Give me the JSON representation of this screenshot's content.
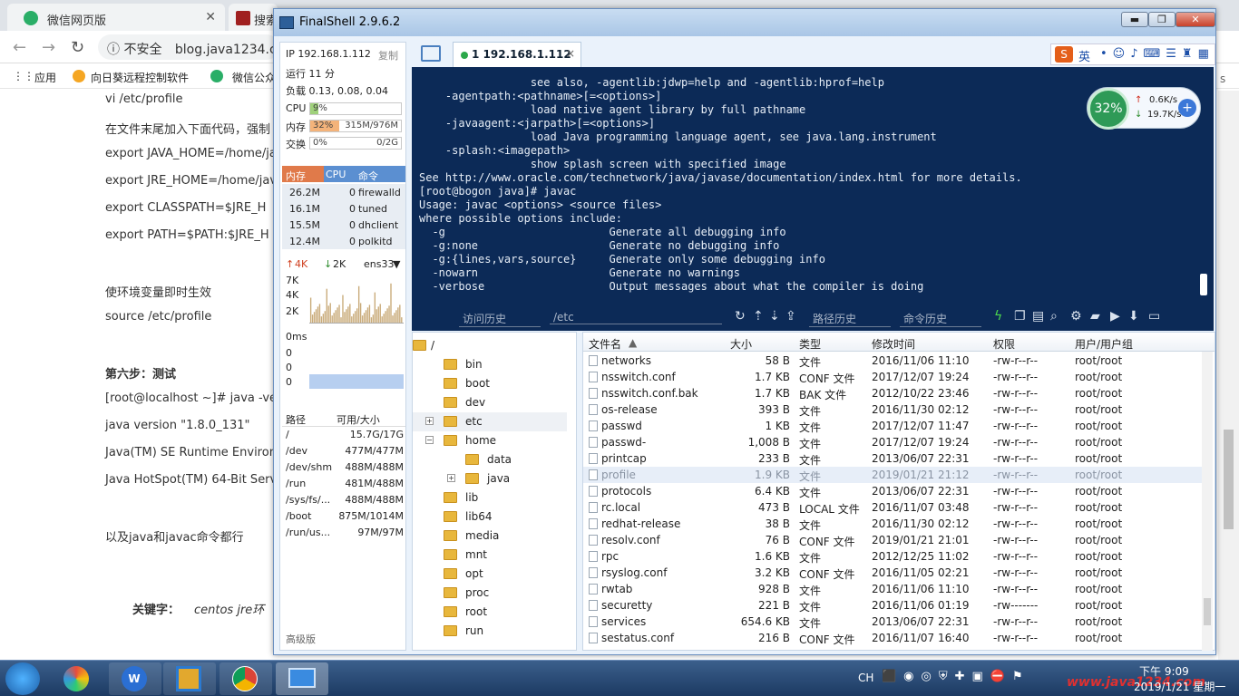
{
  "browser": {
    "tabs": [
      {
        "label": "微信网页版",
        "color": "#2aae67"
      },
      {
        "label": "搜索",
        "color": "#a02020"
      }
    ],
    "insecure": "不安全",
    "url": "blog.java1234.c",
    "bookmarks": [
      "应用",
      "向日葵远程控制软件",
      "微信公众"
    ],
    "article": [
      "vi /etc/profile",
      "在文件末尾加入下面代码，强制",
      "export JAVA_HOME=/home/ja",
      "export JRE_HOME=/home/jav",
      "export CLASSPATH=$JRE_H",
      "export PATH=$PATH:$JRE_H",
      "使环境变量即时生效",
      "source /etc/profile",
      "第六步：测试",
      "[root@localhost ~]# java -vers",
      "java version \"1.8.0_131\"",
      "Java(TM) SE Runtime Environ",
      "Java HotSpot(TM) 64-Bit Serv",
      "以及java和javac命令都行"
    ],
    "keywords_label": "关键字：",
    "keywords": "centos    jre环",
    "right_text": "s"
  },
  "window": {
    "title": "FinalShell 2.9.6.2",
    "min": "▬",
    "max": "❐",
    "close": "✕"
  },
  "sysinfo": {
    "ip_label": "IP 192.168.1.112",
    "copy": "复制",
    "uptime": "运行 11 分",
    "load": "负载 0.13, 0.08, 0.04",
    "cpu_label": "CPU",
    "cpu_val": "9%",
    "cpu_pct": 9,
    "mem_label": "内存",
    "mem_val": "32%",
    "mem_detail": "315M/976M",
    "mem_pct": 32,
    "swap_label": "交换",
    "swap_val": "0%",
    "swap_detail": "0/2G",
    "swap_pct": 0,
    "proc_headers": [
      "内存",
      "CPU",
      "命令"
    ],
    "procs": [
      {
        "mem": "26.2M",
        "cpu": "0",
        "cmd": "firewalld"
      },
      {
        "mem": "16.1M",
        "cpu": "0",
        "cmd": "tuned"
      },
      {
        "mem": "15.5M",
        "cpu": "0",
        "cmd": "dhclient"
      },
      {
        "mem": "12.4M",
        "cpu": "0",
        "cmd": "polkitd"
      }
    ],
    "net_up": "4K",
    "net_down": "2K",
    "iface": "ens33",
    "net_scale": [
      "7K",
      "4K",
      "2K"
    ],
    "ping_label": "0ms",
    "ping_scale": [
      "0",
      "0",
      "0"
    ],
    "disk_headers": [
      "路径",
      "可用/大小"
    ],
    "disks": [
      {
        "path": "/",
        "size": "15.7G/17G"
      },
      {
        "path": "/dev",
        "size": "477M/477M"
      },
      {
        "path": "/dev/shm",
        "size": "488M/488M"
      },
      {
        "path": "/run",
        "size": "481M/488M"
      },
      {
        "path": "/sys/fs/...",
        "size": "488M/488M"
      },
      {
        "path": "/boot",
        "size": "875M/1014M"
      },
      {
        "path": "/run/us...",
        "size": "97M/97M"
      }
    ],
    "advanced": "高级版"
  },
  "session_tab": {
    "label": "1 192.168.1.112",
    "close": "×"
  },
  "terminal_lines": [
    "                 see also, -agentlib:jdwp=help and -agentlib:hprof=help",
    "    -agentpath:<pathname>[=<options>]",
    "                 load native agent library by full pathname",
    "    -javaagent:<jarpath>[=<options>]",
    "                 load Java programming language agent, see java.lang.instrument",
    "    -splash:<imagepath>",
    "                 show splash screen with specified image",
    "See http://www.oracle.com/technetwork/java/javase/documentation/index.html for more details.",
    "[root@bogon java]# javac",
    "Usage: javac <options> <source files>",
    "where possible options include:",
    "  -g                         Generate all debugging info",
    "  -g:none                    Generate no debugging info",
    "  -g:{lines,vars,source}     Generate only some debugging info",
    "  -nowarn                    Generate no warnings",
    "  -verbose                   Output messages about what the compiler is doing"
  ],
  "term_toolbar": {
    "history": "访问历史",
    "path": "/etc",
    "path_history": "路径历史",
    "cmd_history": "命令历史"
  },
  "netwidget": {
    "pct": "32%",
    "up": "0.6K/s",
    "down": "19.7K/s"
  },
  "tree": [
    {
      "label": "/",
      "indent": 0,
      "exp": ""
    },
    {
      "label": "bin",
      "indent": 1,
      "exp": ""
    },
    {
      "label": "boot",
      "indent": 1,
      "exp": ""
    },
    {
      "label": "dev",
      "indent": 1,
      "exp": ""
    },
    {
      "label": "etc",
      "indent": 1,
      "exp": "+"
    },
    {
      "label": "home",
      "indent": 1,
      "exp": "−"
    },
    {
      "label": "data",
      "indent": 2,
      "exp": ""
    },
    {
      "label": "java",
      "indent": 2,
      "exp": "+"
    },
    {
      "label": "lib",
      "indent": 1,
      "exp": ""
    },
    {
      "label": "lib64",
      "indent": 1,
      "exp": ""
    },
    {
      "label": "media",
      "indent": 1,
      "exp": ""
    },
    {
      "label": "mnt",
      "indent": 1,
      "exp": ""
    },
    {
      "label": "opt",
      "indent": 1,
      "exp": ""
    },
    {
      "label": "proc",
      "indent": 1,
      "exp": ""
    },
    {
      "label": "root",
      "indent": 1,
      "exp": ""
    },
    {
      "label": "run",
      "indent": 1,
      "exp": ""
    }
  ],
  "files": {
    "headers": [
      "文件名",
      "大小",
      "类型",
      "修改时间",
      "权限",
      "用户/用户组"
    ],
    "rows": [
      [
        "networks",
        "58 B",
        "文件",
        "2016/11/06 11:10",
        "-rw-r--r--",
        "root/root"
      ],
      [
        "nsswitch.conf",
        "1.7 KB",
        "CONF 文件",
        "2017/12/07 19:24",
        "-rw-r--r--",
        "root/root"
      ],
      [
        "nsswitch.conf.bak",
        "1.7 KB",
        "BAK 文件",
        "2012/10/22 23:46",
        "-rw-r--r--",
        "root/root"
      ],
      [
        "os-release",
        "393 B",
        "文件",
        "2016/11/30 02:12",
        "-rw-r--r--",
        "root/root"
      ],
      [
        "passwd",
        "1 KB",
        "文件",
        "2017/12/07 11:47",
        "-rw-r--r--",
        "root/root"
      ],
      [
        "passwd-",
        "1,008 B",
        "文件",
        "2017/12/07 19:24",
        "-rw-r--r--",
        "root/root"
      ],
      [
        "printcap",
        "233 B",
        "文件",
        "2013/06/07 22:31",
        "-rw-r--r--",
        "root/root"
      ],
      [
        "profile",
        "1.9 KB",
        "文件",
        "2019/01/21 21:12",
        "-rw-r--r--",
        "root/root"
      ],
      [
        "protocols",
        "6.4 KB",
        "文件",
        "2013/06/07 22:31",
        "-rw-r--r--",
        "root/root"
      ],
      [
        "rc.local",
        "473 B",
        "LOCAL 文件",
        "2016/11/07 03:48",
        "-rw-r--r--",
        "root/root"
      ],
      [
        "redhat-release",
        "38 B",
        "文件",
        "2016/11/30 02:12",
        "-rw-r--r--",
        "root/root"
      ],
      [
        "resolv.conf",
        "76 B",
        "CONF 文件",
        "2019/01/21 21:01",
        "-rw-r--r--",
        "root/root"
      ],
      [
        "rpc",
        "1.6 KB",
        "文件",
        "2012/12/25 11:02",
        "-rw-r--r--",
        "root/root"
      ],
      [
        "rsyslog.conf",
        "3.2 KB",
        "CONF 文件",
        "2016/11/05 02:21",
        "-rw-r--r--",
        "root/root"
      ],
      [
        "rwtab",
        "928 B",
        "文件",
        "2016/11/06 11:10",
        "-rw-r--r--",
        "root/root"
      ],
      [
        "securetty",
        "221 B",
        "文件",
        "2016/11/06 01:19",
        "-rw-------",
        "root/root"
      ],
      [
        "services",
        "654.6 KB",
        "文件",
        "2013/06/07 22:31",
        "-rw-r--r--",
        "root/root"
      ],
      [
        "sestatus.conf",
        "216 B",
        "CONF 文件",
        "2016/11/07 16:40",
        "-rw-r--r--",
        "root/root"
      ]
    ],
    "selected_row": 7
  },
  "ime": {
    "lang": "英"
  },
  "taskbar": {
    "lang": "CH",
    "time": "下午 9:09",
    "date": "2019/1/21 星期一",
    "watermark": "www.java1234.com"
  },
  "colors": {
    "terminal_bg": "#0c2a57",
    "accent": "#5b8fd1",
    "cpu_fill": "#9fd17a",
    "mem_fill": "#f4b37a"
  }
}
